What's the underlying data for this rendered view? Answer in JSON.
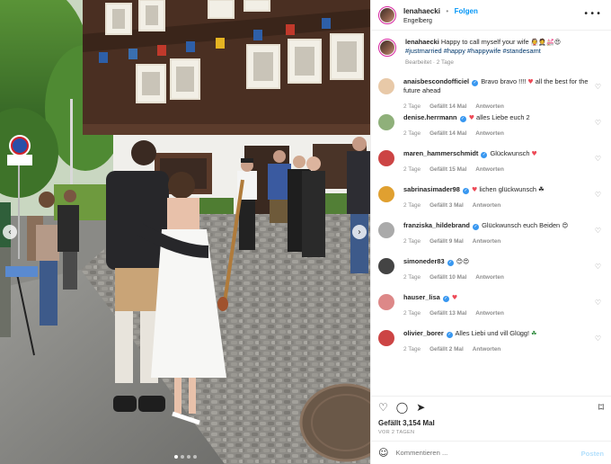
{
  "header": {
    "username": "lenahaecki",
    "follow_label": "Folgen",
    "location": "Engelberg",
    "more_label": "•••"
  },
  "caption": {
    "username": "lenahaecki",
    "text": "Happy to call myself your wife",
    "emojis": "👰🤵💒😍",
    "hashtags": "#justmarried #happy #happywife #standesamt",
    "meta": "Bearbeitet · 2 Tage"
  },
  "comments": [
    {
      "user": "anaisbescondofficiel",
      "verified": true,
      "text_before": "Bravo bravo !!!!",
      "icon": "red-heart",
      "icon_glyph": "♥",
      "text_after": "all the best for the future ahead",
      "age": "2 Tage",
      "likes": "Gefällt 14 Mal",
      "reply": "Antworten"
    },
    {
      "user": "denise.herrmann",
      "verified": true,
      "text_before": "",
      "icon": "red-heart",
      "icon_glyph": "♥",
      "text_after": "alles Liebe euch 2",
      "age": "2 Tage",
      "likes": "Gefällt 14 Mal",
      "reply": "Antworten"
    },
    {
      "user": "maren_hammerschmidt",
      "verified": true,
      "text_before": "Glückwunsch",
      "icon": "red-heart",
      "icon_glyph": "♥",
      "text_after": "",
      "age": "2 Tage",
      "likes": "Gefällt 15 Mal",
      "reply": "Antworten"
    },
    {
      "user": "sabrinasimader98",
      "verified": true,
      "text_before": "",
      "icon": "red-heart",
      "icon_glyph": "♥",
      "text_after": "lichen glückwunsch ☘",
      "age": "2 Tage",
      "likes": "Gefällt 3 Mal",
      "reply": "Antworten"
    },
    {
      "user": "franziska_hildebrand",
      "verified": true,
      "text_before": "Glückwunsch euch Beiden",
      "icon": "heart-eyes-emoji",
      "icon_glyph": "😍",
      "text_after": "",
      "age": "2 Tage",
      "likes": "Gefällt 9 Mal",
      "reply": "Antworten"
    },
    {
      "user": "simoneder83",
      "verified": true,
      "text_before": "",
      "icon": "emoji",
      "icon_glyph": "😊😍",
      "text_after": "",
      "age": "2 Tage",
      "likes": "Gefällt 10 Mal",
      "reply": "Antworten"
    },
    {
      "user": "hauser_lisa",
      "verified": true,
      "text_before": "",
      "icon": "red-heart",
      "icon_glyph": "♥",
      "text_after": "",
      "age": "2 Tage",
      "likes": "Gefällt 13 Mal",
      "reply": "Antworten"
    },
    {
      "user": "olivier_borer",
      "verified": true,
      "text_before": "Alles Liebi und vill Glügg!",
      "icon": "clover-emoji",
      "icon_glyph": "☘",
      "text_after": "",
      "age": "2 Tage",
      "likes": "Gefällt 2 Mal",
      "reply": "Antworten"
    }
  ],
  "footer": {
    "likes": "Gefällt 3,154 Mal",
    "date": "VOR 2 TAGEN",
    "comment_placeholder": "Kommentieren ...",
    "post_label": "Posten"
  },
  "colors": {
    "accent": "#0095f6",
    "heart": "#ed4956",
    "verified": "#3897f0",
    "hashtag": "#00376b"
  }
}
